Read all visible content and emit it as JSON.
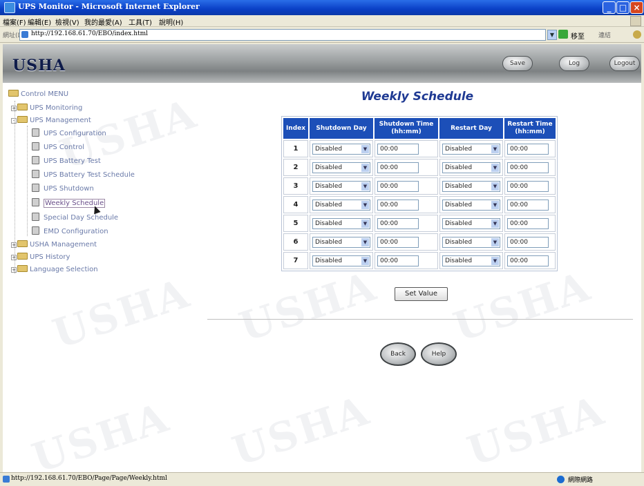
{
  "window": {
    "title": "UPS Monitor - Microsoft Internet Explorer"
  },
  "menubar": {
    "items": [
      "檔案(F)",
      "編輯(E)",
      "檢視(V)",
      "我的最愛(A)",
      "工具(T)",
      "說明(H)"
    ]
  },
  "address": {
    "label": "網址(D)",
    "url": "http://192.168.61.70/EBO/index.html",
    "go_label": "移至",
    "links_label": "連結"
  },
  "banner": {
    "brand": "USHA",
    "buttons": [
      "Save",
      "Log",
      "Logout"
    ]
  },
  "tree": {
    "root": "Control MENU",
    "folders": {
      "monitoring": "UPS Monitoring",
      "management": "UPS Management",
      "usha_management": "USHA Management",
      "history": "UPS History",
      "language": "Language Selection"
    },
    "management_items": [
      "UPS Configuration",
      "UPS Control",
      "UPS Battery Test",
      "UPS Battery Test Schedule",
      "UPS Shutdown",
      "Weekly Schedule",
      "Special Day Schedule",
      "EMD Configuration"
    ],
    "selected": "Weekly Schedule"
  },
  "main": {
    "title": "Weekly Schedule",
    "columns": {
      "index": "Index",
      "shutdown_day": "Shutdown Day",
      "shutdown_time": "Shutdown Time",
      "shutdown_time_unit": "(hh:mm)",
      "restart_day": "Restart Day",
      "restart_time": "Restart Time",
      "restart_time_unit": "(hh:mm)"
    },
    "rows": [
      {
        "index": "1",
        "shutdown_day": "Disabled",
        "shutdown_time": "00:00",
        "restart_day": "Disabled",
        "restart_time": "00:00"
      },
      {
        "index": "2",
        "shutdown_day": "Disabled",
        "shutdown_time": "00:00",
        "restart_day": "Disabled",
        "restart_time": "00:00"
      },
      {
        "index": "3",
        "shutdown_day": "Disabled",
        "shutdown_time": "00:00",
        "restart_day": "Disabled",
        "restart_time": "00:00"
      },
      {
        "index": "4",
        "shutdown_day": "Disabled",
        "shutdown_time": "00:00",
        "restart_day": "Disabled",
        "restart_time": "00:00"
      },
      {
        "index": "5",
        "shutdown_day": "Disabled",
        "shutdown_time": "00:00",
        "restart_day": "Disabled",
        "restart_time": "00:00"
      },
      {
        "index": "6",
        "shutdown_day": "Disabled",
        "shutdown_time": "00:00",
        "restart_day": "Disabled",
        "restart_time": "00:00"
      },
      {
        "index": "7",
        "shutdown_day": "Disabled",
        "shutdown_time": "00:00",
        "restart_day": "Disabled",
        "restart_time": "00:00"
      }
    ],
    "set_value_label": "Set Value",
    "back_label": "Back",
    "help_label": "Help"
  },
  "watermark": "USHA",
  "status": {
    "text": "http://192.168.61.70/EBO/Page/Page/Weekly.html",
    "zone": "網際網路"
  },
  "colors": {
    "header_blue": "#1c4fb8",
    "title_blue": "#1f3a93",
    "menu_text": "#6979a8"
  }
}
